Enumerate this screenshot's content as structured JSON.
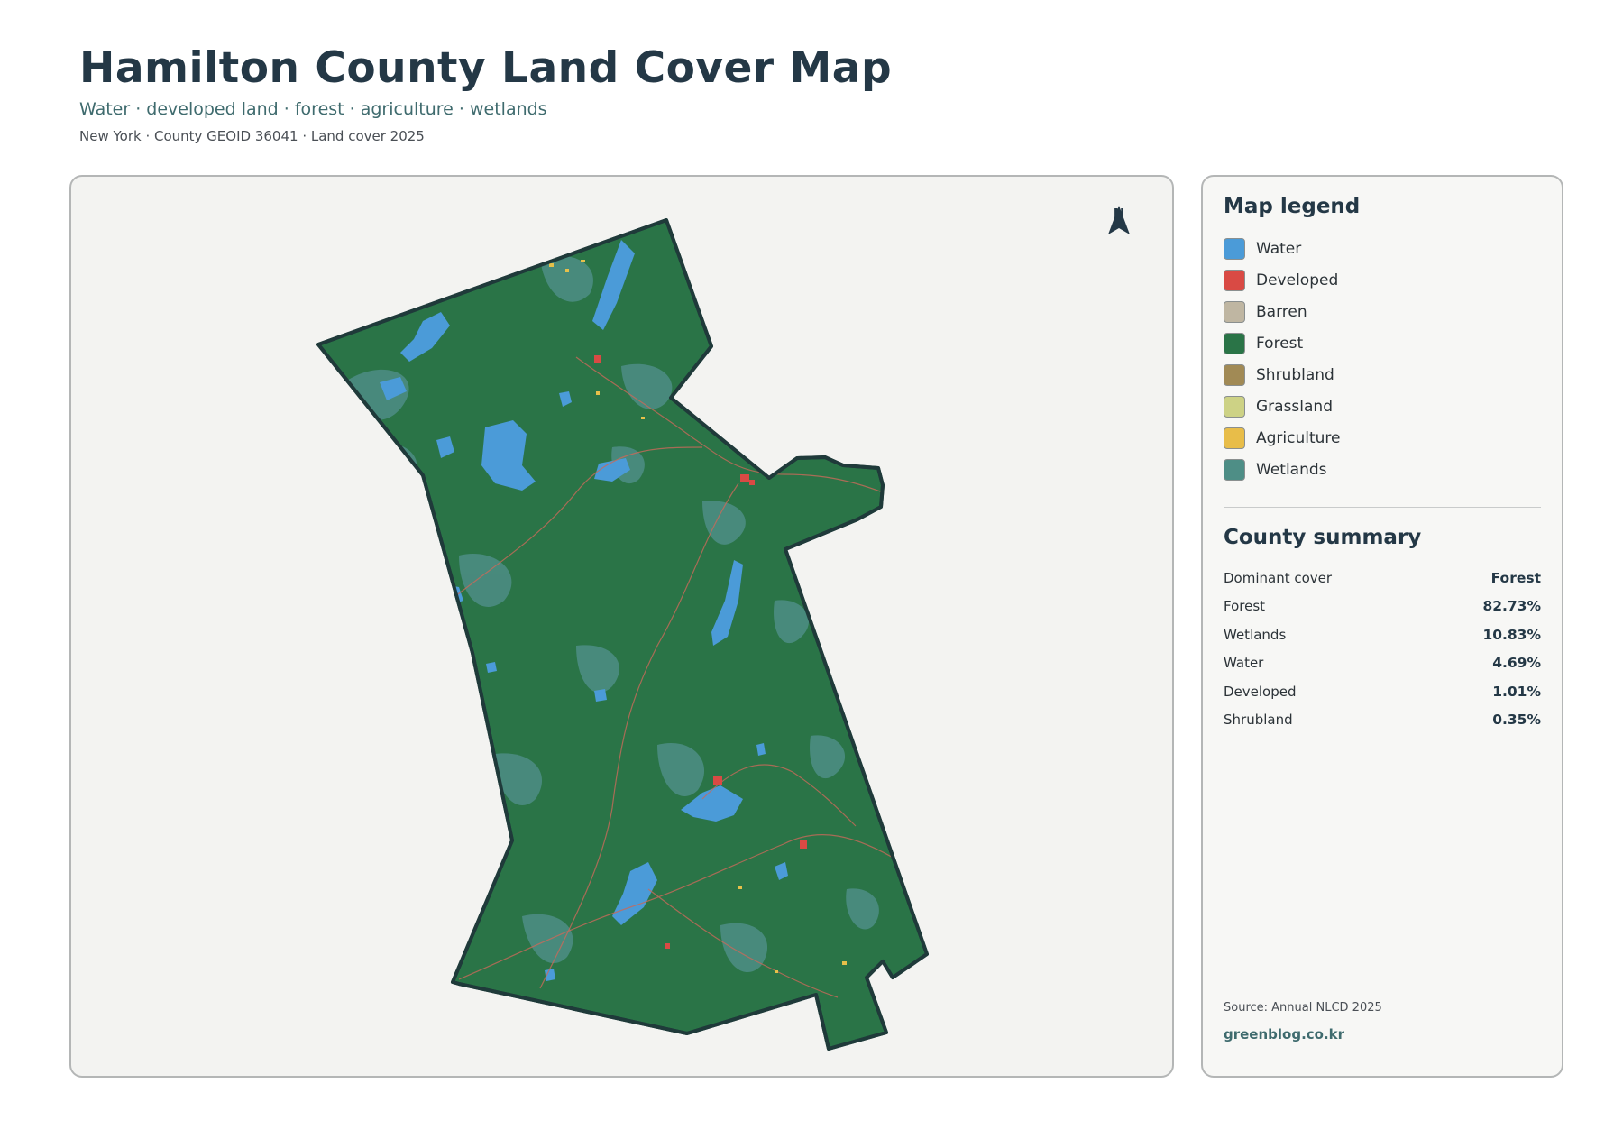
{
  "header": {
    "title": "Hamilton County Land Cover Map",
    "subtitle": "Water · developed land · forest · agriculture · wetlands",
    "meta": "New York · County GEOID 36041 · Land cover 2025"
  },
  "map": {
    "north_label": "N",
    "colors": {
      "forest": "#2a7447",
      "boundary": "#1f3a3a",
      "water": "#4b9bd8",
      "wetlands": "#4e8e86",
      "developed": "#d94a44",
      "agriculture": "#e6c04a",
      "grassland": "#c9cf7c"
    }
  },
  "legend": {
    "title": "Map legend",
    "items": [
      {
        "label": "Water",
        "color": "#4b9bd8"
      },
      {
        "label": "Developed",
        "color": "#d94a44"
      },
      {
        "label": "Barren",
        "color": "#bfb6a2"
      },
      {
        "label": "Forest",
        "color": "#2a7447"
      },
      {
        "label": "Shrubland",
        "color": "#a18a55"
      },
      {
        "label": "Grassland",
        "color": "#cdd285"
      },
      {
        "label": "Agriculture",
        "color": "#e8bd49"
      },
      {
        "label": "Wetlands",
        "color": "#4e8e86"
      }
    ]
  },
  "summary": {
    "title": "County summary",
    "rows": [
      {
        "label": "Dominant cover",
        "value": "Forest"
      },
      {
        "label": "Forest",
        "value": "82.73%"
      },
      {
        "label": "Wetlands",
        "value": "10.83%"
      },
      {
        "label": "Water",
        "value": "4.69%"
      },
      {
        "label": "Developed",
        "value": "1.01%"
      },
      {
        "label": "Shrubland",
        "value": "0.35%"
      }
    ]
  },
  "footer": {
    "source": "Source: Annual NLCD 2025",
    "site": "greenblog.co.kr"
  }
}
